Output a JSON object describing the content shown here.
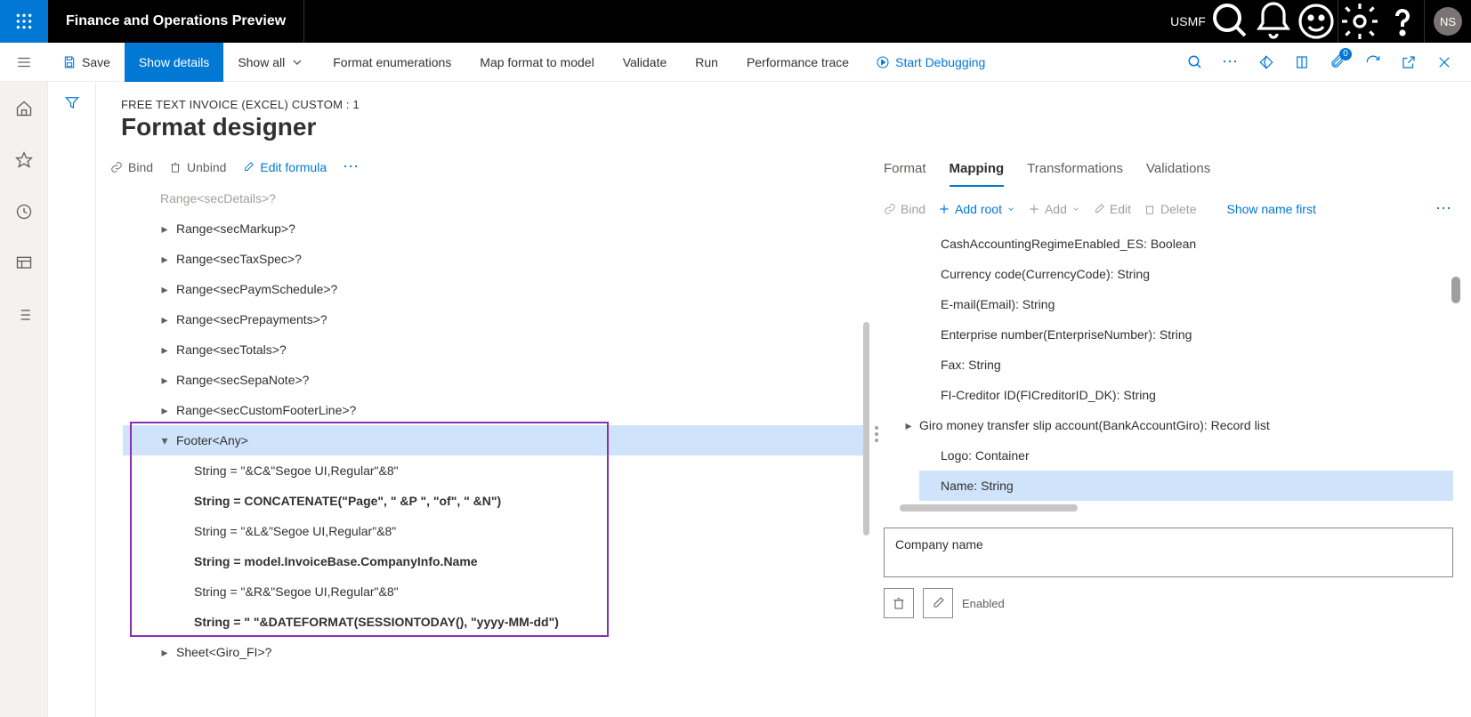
{
  "topbar": {
    "app_title": "Finance and Operations Preview",
    "company": "USMF",
    "avatar": "NS",
    "badge": "0"
  },
  "cmd": {
    "save": "Save",
    "show_details": "Show details",
    "show_all": "Show all",
    "format_enum": "Format enumerations",
    "map_format": "Map format to model",
    "validate": "Validate",
    "run": "Run",
    "perf": "Performance trace",
    "start_debug": "Start Debugging"
  },
  "header": {
    "breadcrumb": "FREE TEXT INVOICE (EXCEL) CUSTOM : 1",
    "title": "Format designer"
  },
  "tree_toolbar": {
    "bind": "Bind",
    "unbind": "Unbind",
    "edit_formula": "Edit formula"
  },
  "tree": {
    "n0": "Range<secDetails>?",
    "n1": "Range<secMarkup>?",
    "n2": "Range<secTaxSpec>?",
    "n3": "Range<secPaymSchedule>?",
    "n4": "Range<secPrepayments>?",
    "n5": "Range<secTotals>?",
    "n6": "Range<secSepaNote>?",
    "n7": "Range<secCustomFooterLine>?",
    "n8": "Footer<Any>",
    "n9": "String = \"&C&\"Segoe UI,Regular\"&8\"",
    "n10": "String = CONCATENATE(\"Page\", \" &P \", \"of\", \" &N\")",
    "n11": "String = \"&L&\"Segoe UI,Regular\"&8\"",
    "n12": "String = model.InvoiceBase.CompanyInfo.Name",
    "n13": "String = \"&R&\"Segoe UI,Regular\"&8\"",
    "n14": "String = \"  \"&DATEFORMAT(SESSIONTODAY(), \"yyyy-MM-dd\")",
    "n15": "Sheet<Giro_FI>?"
  },
  "tabs": {
    "format": "Format",
    "mapping": "Mapping",
    "transformations": "Transformations",
    "validations": "Validations"
  },
  "map_toolbar": {
    "bind": "Bind",
    "add_root": "Add root",
    "add": "Add",
    "edit": "Edit",
    "delete": "Delete",
    "show_name_first": "Show name first"
  },
  "map_list": {
    "r0": "CashAccountingRegimeEnabled_ES: Boolean",
    "r1": "Currency code(CurrencyCode): String",
    "r2": "E-mail(Email): String",
    "r3": "Enterprise number(EnterpriseNumber): String",
    "r4": "Fax: String",
    "r5": "FI-Creditor ID(FICreditorID_DK): String",
    "r6": "Giro money transfer slip account(BankAccountGiro): Record list",
    "r7": "Logo: Container",
    "r8": "Name: String"
  },
  "detail": {
    "company_name": "Company name",
    "enabled": "Enabled"
  }
}
